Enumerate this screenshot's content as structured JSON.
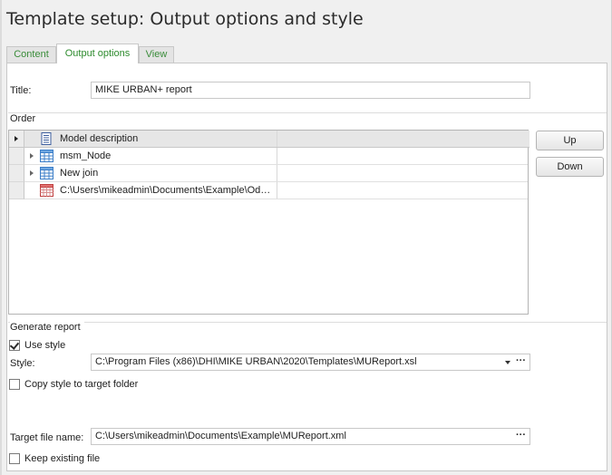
{
  "window": {
    "title": "Template setup: Output options and style"
  },
  "tabs": [
    {
      "label": "Content",
      "active": false
    },
    {
      "label": "Output options",
      "active": true
    },
    {
      "label": "View",
      "active": false
    }
  ],
  "title_field": {
    "label": "Title:",
    "value": "MIKE URBAN+ report"
  },
  "order": {
    "caption": "Order",
    "grid": {
      "header": "Model description",
      "rows": [
        {
          "text": "msm_Node",
          "icon": "table-icon",
          "expandable": true
        },
        {
          "text": "New join",
          "icon": "table-icon",
          "expandable": true
        },
        {
          "text": "C:\\Users\\mikeadmin\\Documents\\Example\\Od…",
          "icon": "spreadsheet-icon",
          "expandable": false
        }
      ]
    },
    "up_label": "Up",
    "down_label": "Down"
  },
  "generate_report": {
    "caption": "Generate report",
    "use_style": {
      "label": "Use style",
      "checked": true
    },
    "style": {
      "label": "Style:",
      "value": "C:\\Program Files (x86)\\DHI\\MIKE URBAN\\2020\\Templates\\MUReport.xsl"
    },
    "copy_style": {
      "label": "Copy style to target folder",
      "checked": false
    },
    "target_file": {
      "label": "Target file name:",
      "value": "C:\\Users\\mikeadmin\\Documents\\Example\\MUReport.xml"
    },
    "keep_existing": {
      "label": "Keep existing file",
      "checked": false
    }
  },
  "colors": {
    "tab_text": "#2e8b2e",
    "grid_header": "#e6e6e6",
    "table_icon": "#3d7fc9",
    "spreadsheet_icon": "#c04040"
  }
}
